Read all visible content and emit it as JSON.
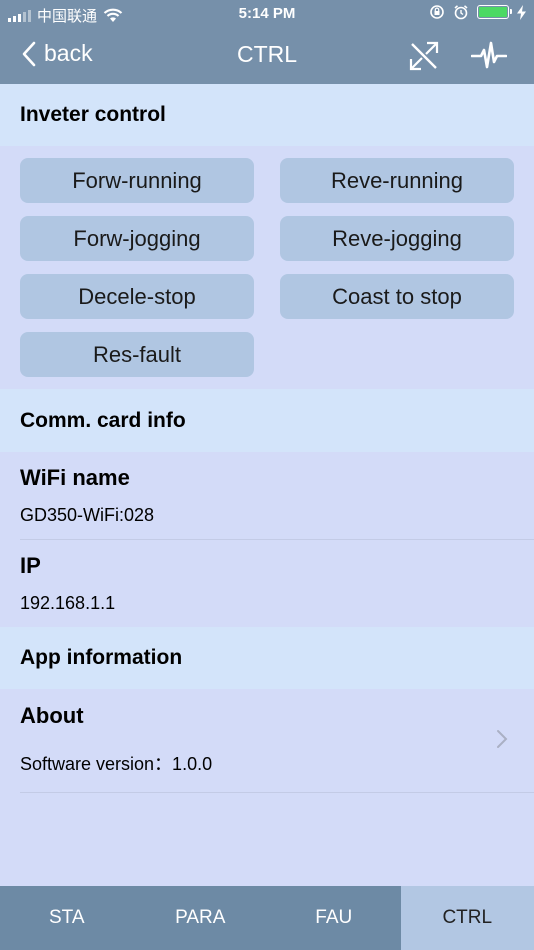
{
  "status_bar": {
    "carrier": "中国联通",
    "time": "5:14 PM"
  },
  "nav": {
    "back_label": "back",
    "title": "CTRL",
    "icons": [
      "no-connection-icon",
      "waveform-icon"
    ]
  },
  "control": {
    "header": "Inveter control",
    "buttons": [
      "Forw-running",
      "Reve-running",
      "Forw-jogging",
      "Reve-jogging",
      "Decele-stop",
      "Coast to stop",
      "Res-fault"
    ]
  },
  "comm": {
    "header": "Comm. card info",
    "wifi_label": "WiFi name",
    "wifi_value": "GD350-WiFi:028",
    "ip_label": "IP",
    "ip_value": "192.168.1.1"
  },
  "app": {
    "header": "App information",
    "about_label": "About",
    "version": "Software version：1.0.0"
  },
  "tabs": [
    {
      "label": "STA",
      "active": false
    },
    {
      "label": "PARA",
      "active": false
    },
    {
      "label": "FAU",
      "active": false
    },
    {
      "label": "CTRL",
      "active": true
    }
  ],
  "colors": {
    "nav_bg": "#7690aa",
    "button_bg": "#b0c6e2",
    "page_bg": "#d3dbf8",
    "header_bg": "#d3e4fa",
    "battery": "#4cd964"
  }
}
